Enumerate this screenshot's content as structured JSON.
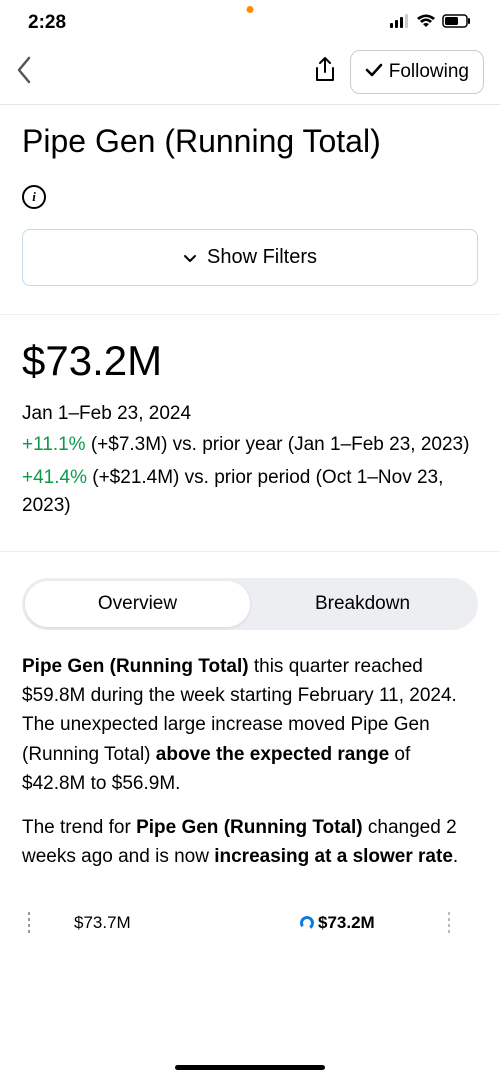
{
  "status": {
    "time": "2:28"
  },
  "nav": {
    "following_label": "Following"
  },
  "title": "Pipe Gen (Running Total)",
  "filters": {
    "label": "Show Filters"
  },
  "metric": {
    "value": "$73.2M",
    "date_range": "Jan 1–Feb 23, 2024",
    "compare1_pct": "+11.1%",
    "compare1_rest": " (+$7.3M) vs. prior year (Jan 1–Feb 23, 2023)",
    "compare2_pct": "+41.4%",
    "compare2_rest": " (+$21.4M) vs. prior period (Oct 1–Nov 23, 2023)"
  },
  "tabs": {
    "overview": "Overview",
    "breakdown": "Breakdown"
  },
  "insights": {
    "p1_bold1": "Pipe Gen (Running Total)",
    "p1_mid": " this quarter reached $59.8M during the week starting February 11, 2024. The unexpected large increase moved Pipe Gen (Running Total) ",
    "p1_bold2": "above the expected range",
    "p1_end": " of $42.8M to $56.9M.",
    "p2_start": "The trend for ",
    "p2_bold1": "Pipe Gen (Running Total)",
    "p2_mid": " changed 2 weeks ago and is now ",
    "p2_bold2": "increasing at a slower rate",
    "p2_end": "."
  },
  "chart": {
    "left_value": "$73.7M",
    "right_value": "$73.2M"
  }
}
